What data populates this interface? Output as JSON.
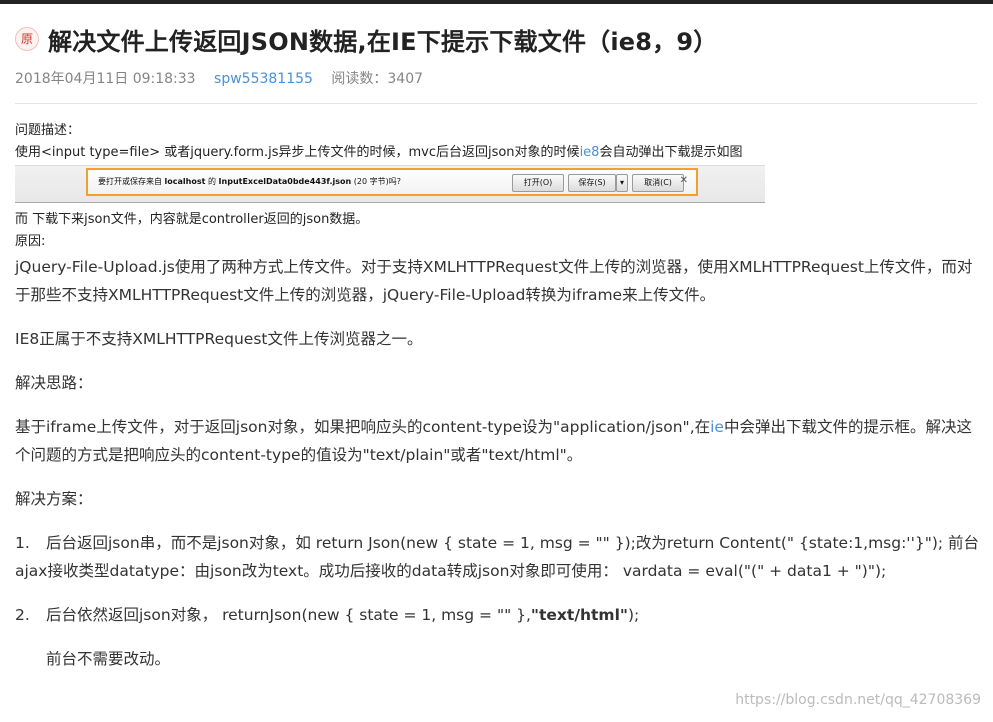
{
  "header": {
    "badge": "原",
    "title": "解决文件上传返回JSON数据,在IE下提示下载文件（ie8，9）",
    "date": "2018年04月11日 09:18:33",
    "author": "spw55381155",
    "reads_label": "阅读数：3407"
  },
  "article": {
    "problem_label": "问题描述：",
    "problem_line_a": "使用<input type=file> 或者jquery.form.js异步上传文件的时候，mvc后台返回json对象的时候",
    "problem_link": "ie8",
    "problem_line_b": "会自动弹出下载提示如图",
    "dialog": {
      "prompt_a": "要打开或保存来自 ",
      "prompt_host": "localhost",
      "prompt_b": " 的 ",
      "prompt_file": "InputExcelData0bde443f.json",
      "prompt_c": " (20 字节)吗?",
      "open": "打开(O)",
      "save": "保存(S)",
      "cancel": "取消(C)",
      "close": "✕"
    },
    "download_note": "而 下载下来json文件，内容就是controller返回的json数据。",
    "reason_label": " 原因:",
    "reason_p1": "jQuery-File-Upload.js使用了两种方式上传文件。对于支持XMLHTTPRequest文件上传的浏览器，使用XMLHTTPRequest上传文件，而对于那些不支持XMLHTTPRequest文件上传的浏览器，jQuery-File-Upload转换为iframe来上传文件。",
    "reason_p2": "IE8正属于不支持XMLHTTPRequest文件上传浏览器之一。",
    "idea_label": "解决思路：",
    "idea_a": "基于iframe上传文件，对于返回json对象，如果把响应头的content-type设为\"application/json\",在",
    "idea_link": "ie",
    "idea_b": "中会弹出下载文件的提示框。解决这个问题的方式是把响应头的content-type的值设为\"text/plain\"或者\"text/html\"。",
    "plan_label": "解决方案：",
    "item1_num": "1.",
    "item1": "后台返回json串，而不是json对象，如 return Json(new { state = 1, msg = \"\" });改为return Content(\"        {state:1,msg:''}\"); 前台ajax接收类型datatype：由json改为text。成功后接收的data转成json对象即可使用：              vardata = eval(\"(\" + data1 + \")\");",
    "item2_num": "2.",
    "item2_a": "后台依然返回json对象， returnJson(new { state = 1, msg = \"\" },",
    "item2_bold": "\"text/html\"",
    "item2_b": ");",
    "item2_note": "前台不需要改动。"
  },
  "watermark": "https://blog.csdn.net/qq_42708369",
  "colors": {
    "link": "#4a90d9",
    "badge_text": "#c9352a",
    "dialog_border": "#f0a030"
  }
}
